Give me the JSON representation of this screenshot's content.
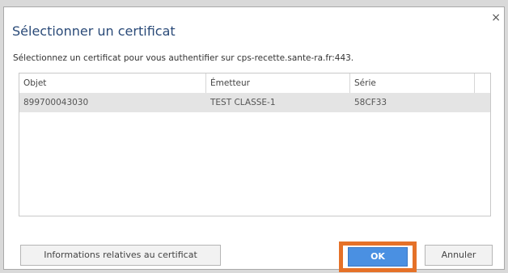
{
  "dialog": {
    "title": "Sélectionner un certificat",
    "close_glyph": "×",
    "prompt": "Sélectionnez un certificat pour vous authentifier sur cps-recette.sante-ra.fr:443."
  },
  "table": {
    "headers": [
      "Objet",
      "Émetteur",
      "Série"
    ],
    "rows": [
      [
        "899700043030",
        "TEST CLASSE-1",
        "58CF33"
      ]
    ]
  },
  "buttons": {
    "info_label": "Informations relatives au certificat",
    "ok_label": "OK",
    "cancel_label": "Annuler"
  },
  "colors": {
    "highlight": "#e57128",
    "ok_button": "#4a90e2",
    "selected_row": "#e4e4e4",
    "title": "#2a4a78"
  },
  "icons": {
    "close": "close-icon"
  }
}
